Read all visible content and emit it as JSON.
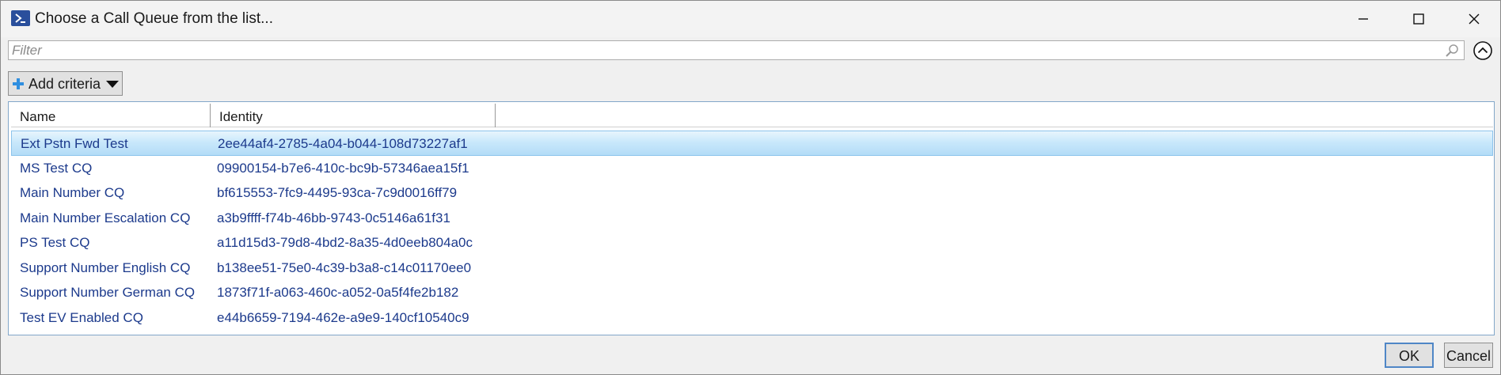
{
  "window": {
    "title": "Choose a Call Queue from the list..."
  },
  "filter": {
    "placeholder": "Filter",
    "value": ""
  },
  "toolbar": {
    "add_criteria_label": "Add criteria"
  },
  "grid": {
    "columns": [
      "Name",
      "Identity"
    ],
    "selected_index": 0,
    "rows": [
      {
        "name": "Ext Pstn Fwd Test",
        "identity": "2ee44af4-2785-4a04-b044-108d73227af1"
      },
      {
        "name": "MS Test CQ",
        "identity": "09900154-b7e6-410c-bc9b-57346aea15f1"
      },
      {
        "name": "Main Number CQ",
        "identity": "bf615553-7fc9-4495-93ca-7c9d0016ff79"
      },
      {
        "name": "Main Number Escalation CQ",
        "identity": "a3b9ffff-f74b-46bb-9743-0c5146a61f31"
      },
      {
        "name": "PS Test CQ",
        "identity": "a11d15d3-79d8-4bd2-8a35-4d0eeb804a0c"
      },
      {
        "name": "Support Number English CQ",
        "identity": "b138ee51-75e0-4c39-b3a8-c14c01170ee0"
      },
      {
        "name": "Support Number German CQ",
        "identity": "1873f71f-a063-460c-a052-0a5f4fe2b182"
      },
      {
        "name": "Test EV Enabled CQ",
        "identity": "e44b6659-7194-462e-a9e9-140cf10540c9"
      }
    ]
  },
  "buttons": {
    "ok_label": "OK",
    "cancel_label": "Cancel"
  },
  "icons": {
    "app": "powershell-icon",
    "search": "search-icon",
    "collapse": "chevron-up-circle-icon",
    "add": "plus-icon",
    "dropdown": "caret-down-icon"
  },
  "colors": {
    "accent": "#4f86c6",
    "row_text": "#1c3a8c",
    "selection": "#c9e8fb"
  }
}
